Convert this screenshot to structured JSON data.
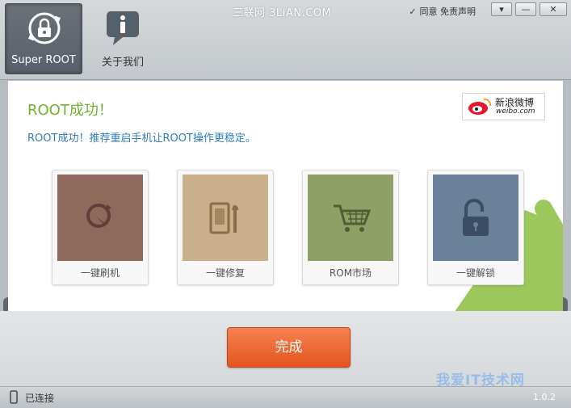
{
  "window": {
    "watermark_top": "三联网 3LIAN.COM",
    "agree_label": "同意",
    "disclaimer_label": "免责声明"
  },
  "nav": {
    "tabs": [
      {
        "label": "Super ROOT",
        "icon": "lock-refresh-icon",
        "active": true
      },
      {
        "label": "关于我们",
        "icon": "info-icon",
        "active": false
      }
    ]
  },
  "main": {
    "title": "ROOT成功！",
    "subtitle": "ROOT成功！推荐重启手机让ROOT操作更稳定。",
    "weibo": {
      "name": "新浪微博",
      "domain": "weibo.com"
    },
    "cards": [
      {
        "label": "一键刷机",
        "icon": "flash-icon",
        "color": "#8e6a5d"
      },
      {
        "label": "一键修复",
        "icon": "repair-tools-icon",
        "color": "#c9b08a"
      },
      {
        "label": "ROM市场",
        "icon": "shopping-cart-icon",
        "color": "#8ea065"
      },
      {
        "label": "一键解锁",
        "icon": "unlock-icon",
        "color": "#6a819a"
      }
    ],
    "done_label": "完成"
  },
  "status": {
    "connection": "已连接",
    "version": "1.0.2",
    "watermark_bottom": "我爱IT技术网"
  },
  "colors": {
    "accent_green": "#72b12e",
    "link_blue": "#2f7cb8",
    "button_orange": "#ea6430"
  }
}
